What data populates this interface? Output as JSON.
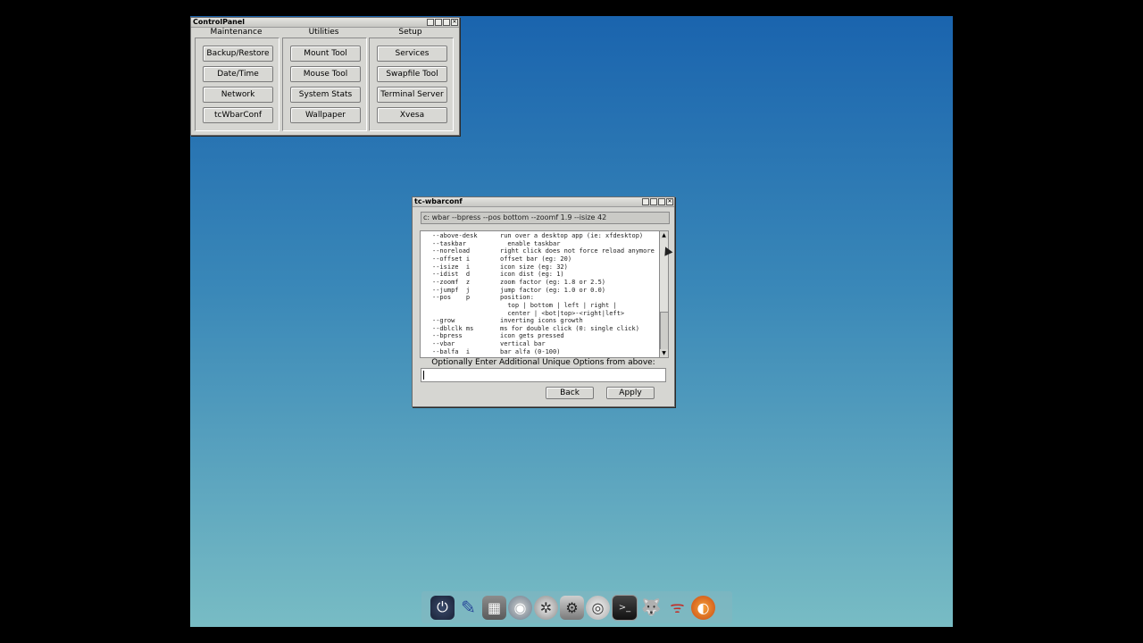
{
  "control_panel": {
    "title": "ControlPanel",
    "groups": [
      {
        "label": "Maintenance",
        "buttons": [
          "Backup/Restore",
          "Date/Time",
          "Network",
          "tcWbarConf"
        ]
      },
      {
        "label": "Utilities",
        "buttons": [
          "Mount Tool",
          "Mouse Tool",
          "System Stats",
          "Wallpaper"
        ]
      },
      {
        "label": "Setup",
        "buttons": [
          "Services",
          "Swapfile Tool",
          "Terminal Server",
          "Xvesa"
        ]
      }
    ]
  },
  "wbarconf": {
    "title": "tc-wbarconf",
    "command": "c: wbar --bpress --pos bottom --zoomf 1.9 --isize 42",
    "options": [
      {
        "k": "--above-desk",
        "d": "run over a desktop app (ie: xfdesktop)"
      },
      {
        "k": "--taskbar",
        "d": "  enable taskbar"
      },
      {
        "k": "--noreload",
        "d": "right click does not force reload anymore"
      },
      {
        "k": "--offset i",
        "d": "offset bar (eg: 20)"
      },
      {
        "k": "--isize  i",
        "d": "icon size (eg: 32)"
      },
      {
        "k": "--idist  d",
        "d": "icon dist (eg: 1)"
      },
      {
        "k": "--zoomf  z",
        "d": "zoom factor (eg: 1.8 or 2.5)"
      },
      {
        "k": "--jumpf  j",
        "d": "jump factor (eg: 1.0 or 0.0)"
      },
      {
        "k": "--pos    p",
        "d": "position:"
      },
      {
        "k": "",
        "d": "  top | bottom | left | right |"
      },
      {
        "k": "",
        "d": "  center | <bot|top>-<right|left>"
      },
      {
        "k": "--grow",
        "d": "inverting icons growth"
      },
      {
        "k": "--dblclk ms",
        "d": "ms for double click (0: single click)"
      },
      {
        "k": "--bpress",
        "d": "icon gets pressed"
      },
      {
        "k": "--vbar",
        "d": "vertical bar"
      },
      {
        "k": "--balfa  i",
        "d": "bar alfa (0-100)"
      }
    ],
    "hint": "Optionally Enter Additional Unique Options from above:",
    "extra_value": "",
    "back_label": "Back",
    "apply_label": "Apply"
  },
  "dock_icons": [
    "power-icon",
    "paintbrush-icon",
    "wbar-config-icon",
    "mount-icon",
    "control-panel-icon",
    "apps-icon",
    "cpanel-settings-icon",
    "terminal-icon",
    "gimp-icon",
    "wireless-icon",
    "firefox-icon"
  ]
}
